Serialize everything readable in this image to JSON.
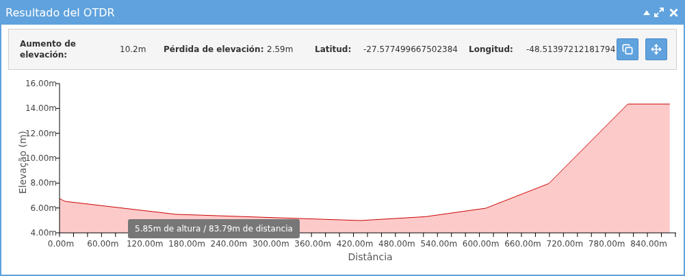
{
  "window": {
    "title": "Resultado del OTDR"
  },
  "summary": [
    {
      "label": "Aumento de elevación:",
      "value": "10.2m"
    },
    {
      "label": "Pérdida de elevación:",
      "value": "2.59m"
    },
    {
      "label": "Latitud:",
      "value": "-27.577499667502384"
    },
    {
      "label": "Longitud:",
      "value": "-48.51397212181794"
    }
  ],
  "chart": {
    "tooltip": "5.85m de altura / 83.79m de distancia",
    "chart_data": {
      "type": "area",
      "xlabel": "Distância",
      "ylabel": "Elevação (m)",
      "x": [
        0,
        8,
        166,
        230,
        330,
        430,
        523,
        609,
        699,
        812,
        872
      ],
      "series": [
        {
          "color": "#cc0000",
          "values": [
            6.75,
            6.53,
            5.49,
            null,
            null,
            4.99,
            5.3,
            5.98,
            7.96,
            14.35,
            14.35
          ]
        }
      ],
      "xlim": [
        0,
        881
      ],
      "ylim": [
        4,
        16
      ],
      "xticks": [
        {
          "value": 0,
          "label": "0.00m"
        },
        {
          "value": 60,
          "label": "60.00m"
        },
        {
          "value": 120,
          "label": "120.00m"
        },
        {
          "value": 180,
          "label": "180.00m"
        },
        {
          "value": 240,
          "label": "240.00m"
        },
        {
          "value": 300,
          "label": "300.00m"
        },
        {
          "value": 360,
          "label": "360.00m"
        },
        {
          "value": 420,
          "label": "420.00m"
        },
        {
          "value": 480,
          "label": "480.00m"
        },
        {
          "value": 540,
          "label": "540.00m"
        },
        {
          "value": 600,
          "label": "600.00m"
        },
        {
          "value": 660,
          "label": "660.00m"
        },
        {
          "value": 720,
          "label": "720.00m"
        },
        {
          "value": 780,
          "label": "780.00m"
        },
        {
          "value": 840,
          "label": "840.00m"
        }
      ],
      "yticks": [
        {
          "value": 4,
          "label": "4.00m"
        },
        {
          "value": 6,
          "label": "6.00m"
        },
        {
          "value": 8,
          "label": "8.00m"
        },
        {
          "value": 10,
          "label": "10.00m"
        },
        {
          "value": 12,
          "label": "12.00m"
        },
        {
          "value": 14,
          "label": "14.00m"
        },
        {
          "value": 16,
          "label": "16.00m"
        }
      ]
    }
  }
}
